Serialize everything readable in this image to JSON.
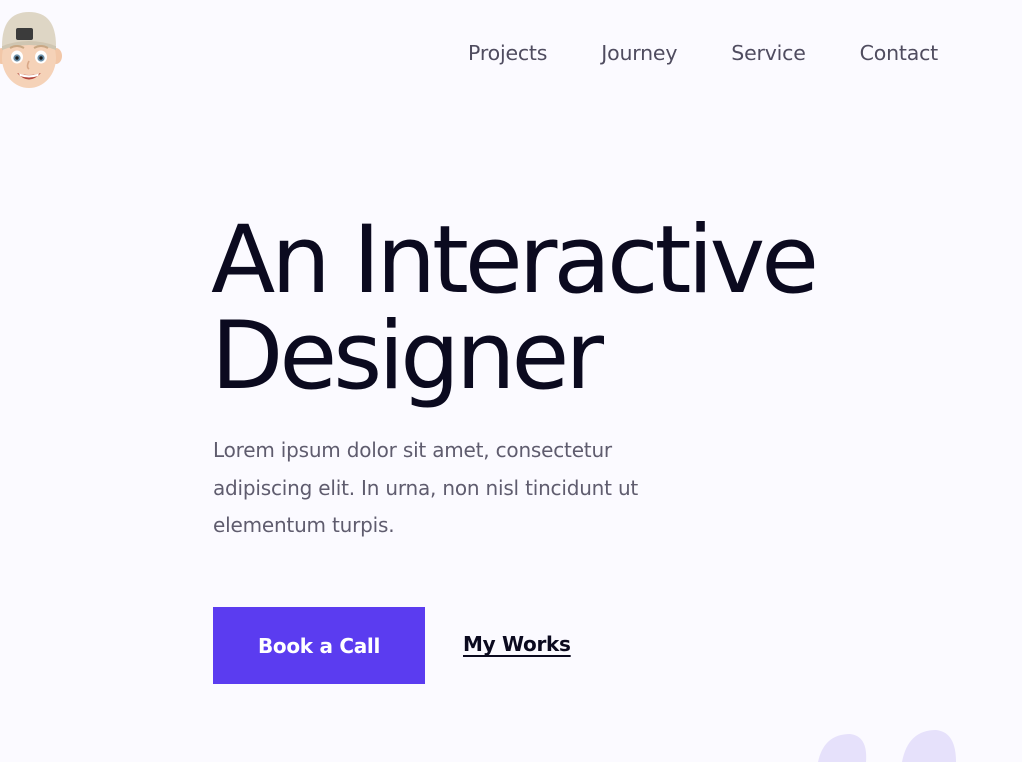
{
  "header": {
    "avatar_icon": "memoji-avatar-icon",
    "nav": [
      {
        "label": "Projects"
      },
      {
        "label": "Journey"
      },
      {
        "label": "Service"
      },
      {
        "label": "Contact"
      }
    ]
  },
  "hero": {
    "title_line1": "An Interactive",
    "title_line2": "Designer",
    "description": "Lorem ipsum dolor sit amet, consectetur adipiscing elit. In urna, non nisl tincidunt ut elementum turpis.",
    "primary_button": "Book a Call",
    "secondary_link": "My Works"
  },
  "colors": {
    "background": "#fbfaff",
    "accent": "#5b3cf0",
    "heading": "#0b0a1f",
    "body_text": "#5f5c6e",
    "nav_text": "#4f4c5f",
    "decoration": "#e6e1fb"
  },
  "decorations": {
    "quote_icon": "quote-mark-icon"
  }
}
